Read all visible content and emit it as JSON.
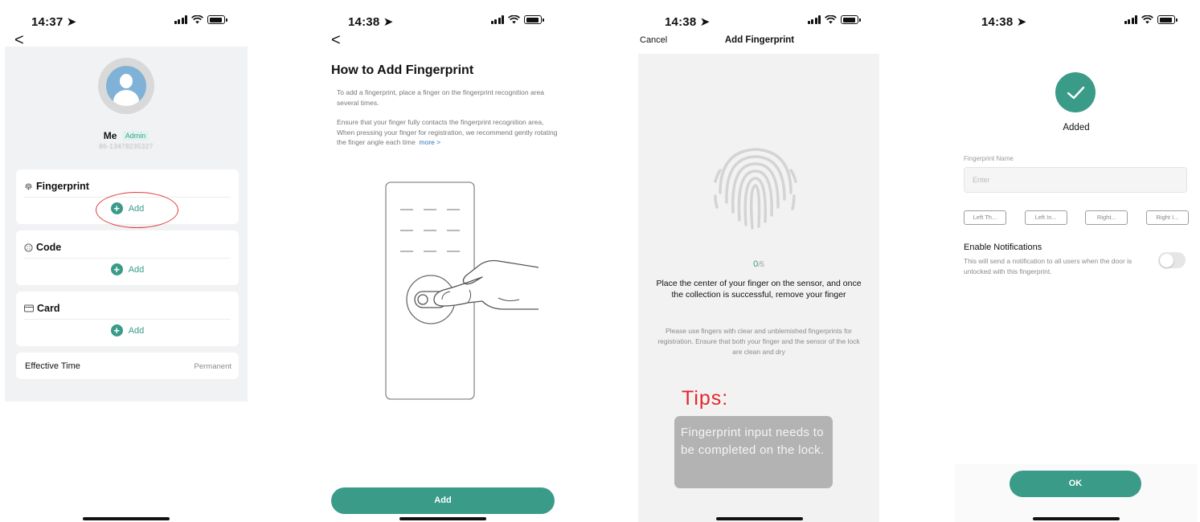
{
  "status_bar": [
    {
      "time": "14:37"
    },
    {
      "time": "14:38"
    },
    {
      "time": "14:38"
    },
    {
      "time": "14:38"
    }
  ],
  "colors": {
    "accent": "#3a9b88",
    "tips_red": "#e4262c",
    "annotation": "#e03a3a"
  },
  "icons": {
    "back": "chevron-left-icon",
    "location": "location-arrow-icon",
    "success": "checkmark-icon"
  },
  "screen1": {
    "user_name": "Me",
    "user_role_badge": "Admin",
    "user_phone": "86-13478235327",
    "sections": [
      {
        "title": "Fingerprint",
        "icon": "fingerprint-icon",
        "add_label": "Add"
      },
      {
        "title": "Code",
        "icon": "keypad-icon",
        "add_label": "Add"
      },
      {
        "title": "Card",
        "icon": "card-icon",
        "add_label": "Add"
      }
    ],
    "effective_time": {
      "label": "Effective Time",
      "value": "Permanent"
    }
  },
  "screen2": {
    "title": "How to Add Fingerprint",
    "paragraph1": "To add a fingerprint, place a finger on the fingerprint recognition area several times.",
    "paragraph2": "Ensure that your finger fully contacts the fingerprint recognition area,  When pressing your finger for registration, we recommend gently rotating the finger angle each time",
    "more_link": "more >",
    "add_button": "Add"
  },
  "screen3": {
    "cancel": "Cancel",
    "title": "Add Fingerprint",
    "progress_current": "0",
    "progress_total": "/5",
    "instruction": "Place the center of your finger on the sensor, and once the collection is successful, remove your finger",
    "note": "Please use fingers with clear and unblemished fingerprints for registration. Ensure that both your finger and the sensor of the lock are clean and dry",
    "tips_label": "Tips:",
    "tips_text": "Fingerprint input needs to be completed on the lock."
  },
  "screen4": {
    "status_text": "Added",
    "name_label": "Fingerprint Name",
    "name_placeholder": "Enter",
    "finger_options": [
      "Left Th...",
      "Left In...",
      "Right...",
      "Right I..."
    ],
    "notify_title": "Enable Notifications",
    "notify_desc": "This will send a notification to all users when the door is unlocked with this fingerprint.",
    "notify_enabled": false,
    "ok_button": "OK"
  }
}
